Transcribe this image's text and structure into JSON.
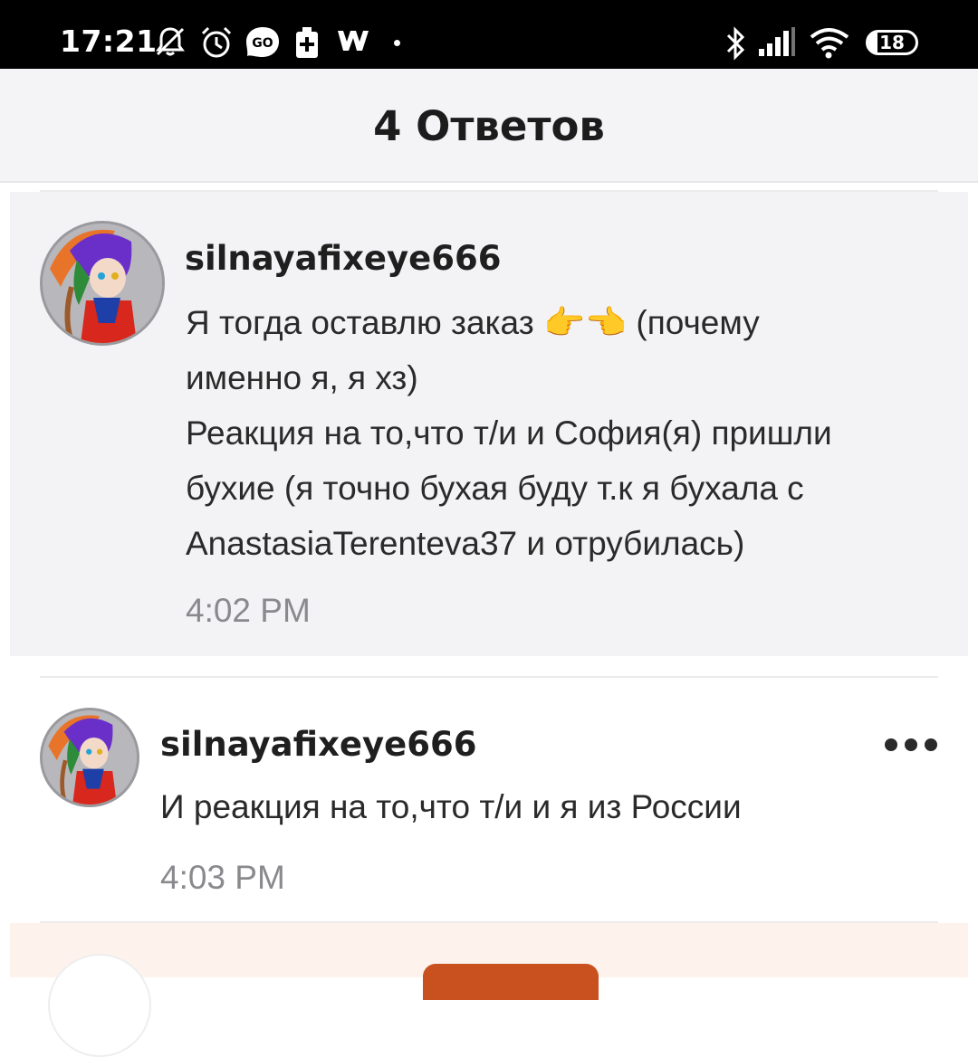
{
  "status_bar": {
    "time": "17:21",
    "icons": [
      "bell-off-icon",
      "alarm-icon",
      "go-app-icon",
      "battery-saver-icon",
      "wattpad-icon",
      "bluetooth-icon",
      "signal-icon",
      "wifi-icon"
    ],
    "battery_level": "18"
  },
  "header": {
    "title": "4 Ответов"
  },
  "comments": [
    {
      "username": "silnayafixeye666",
      "lines": [
        "Я тогда оставлю заказ 👉👈 (почему",
        "именно я, я хз)",
        "Реакция на то,что т/и и София(я) пришли",
        "бухие (я точно бухая буду т.к я бухала с",
        "AnastasiaTerenteva37 и отрубилась)"
      ],
      "time": "4:02 PM"
    },
    {
      "username": "silnayafixeye666",
      "lines": [
        "И реакция на то,что т/и и я из России"
      ],
      "time": "4:03 PM"
    }
  ]
}
